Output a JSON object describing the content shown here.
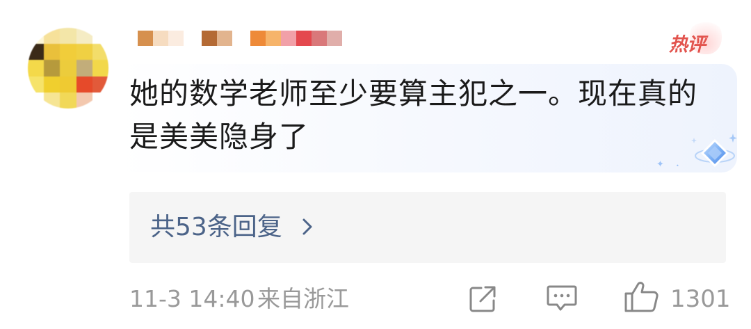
{
  "comment": {
    "text": "她的数学老师至少要算主犯之一。现在真的是美美隐身了"
  },
  "badge": {
    "label": "热评"
  },
  "replies": {
    "label": "共53条回复"
  },
  "meta": {
    "timestamp": "11-3 14:40",
    "location": "来自浙江"
  },
  "actions": {
    "like_count": "1301"
  },
  "colors": {
    "reply_link": "#4b6388",
    "hot_badge": "#e2544e",
    "meta_text": "#999999",
    "reply_bg": "#f5f5f5"
  },
  "icons": {
    "share": "share-icon",
    "comment": "comment-icon",
    "like": "thumbs-up-icon",
    "chevron": "chevron-right-icon"
  }
}
